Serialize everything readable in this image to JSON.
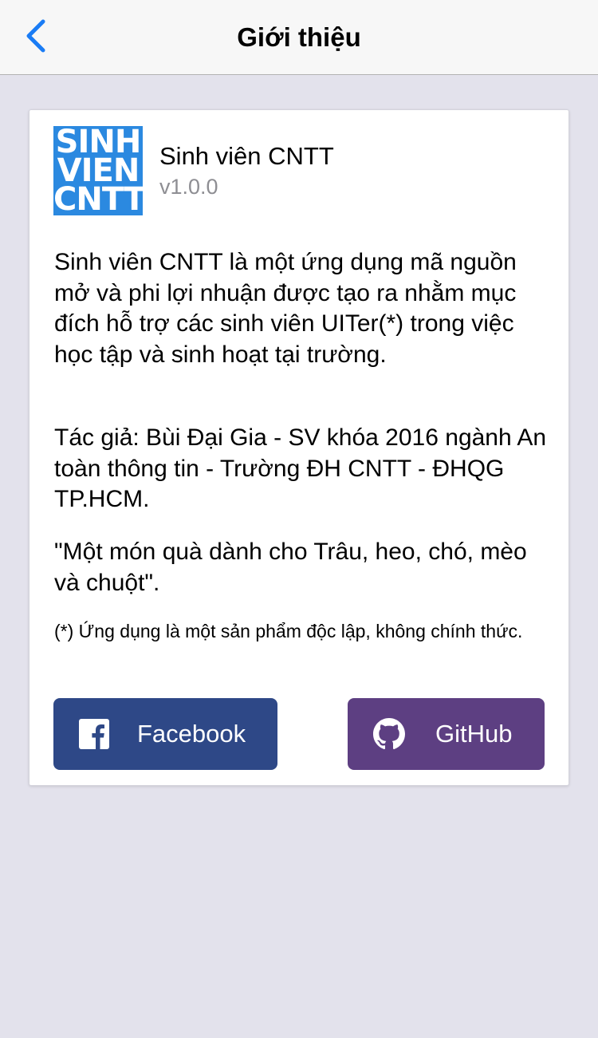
{
  "nav": {
    "title": "Giới thiệu",
    "back_icon": "chevron-left-icon"
  },
  "app": {
    "logo_lines": [
      "SINH",
      "VIEN",
      "CNTT"
    ],
    "name": "Sinh viên CNTT",
    "version": "v1.0.0"
  },
  "content": {
    "description": "Sinh viên CNTT là một ứng dụng mã nguồn mở và phi lợi nhuận được tạo ra nhằm mục đích hỗ trợ các sinh viên UITer(*) trong việc học tập và sinh hoạt tại trường.",
    "author": "Tác giả: Bùi Đại Gia - SV khóa 2016 ngành An toàn thông tin - Trường ĐH CNTT - ĐHQG TP.HCM.",
    "quote": "\"Một món quà dành cho Trâu, heo, chó, mèo và chuột\".",
    "note": "(*) Ứng dụng là một sản phẩm độc lập, không chính thức."
  },
  "buttons": {
    "facebook": {
      "label": "Facebook",
      "icon": "facebook-icon",
      "color": "#2e4887"
    },
    "github": {
      "label": "GitHub",
      "icon": "github-icon",
      "color": "#5d3f82"
    }
  },
  "colors": {
    "accent": "#1a7cf5",
    "background": "#e3e2ec",
    "logo": "#2b89e0"
  }
}
